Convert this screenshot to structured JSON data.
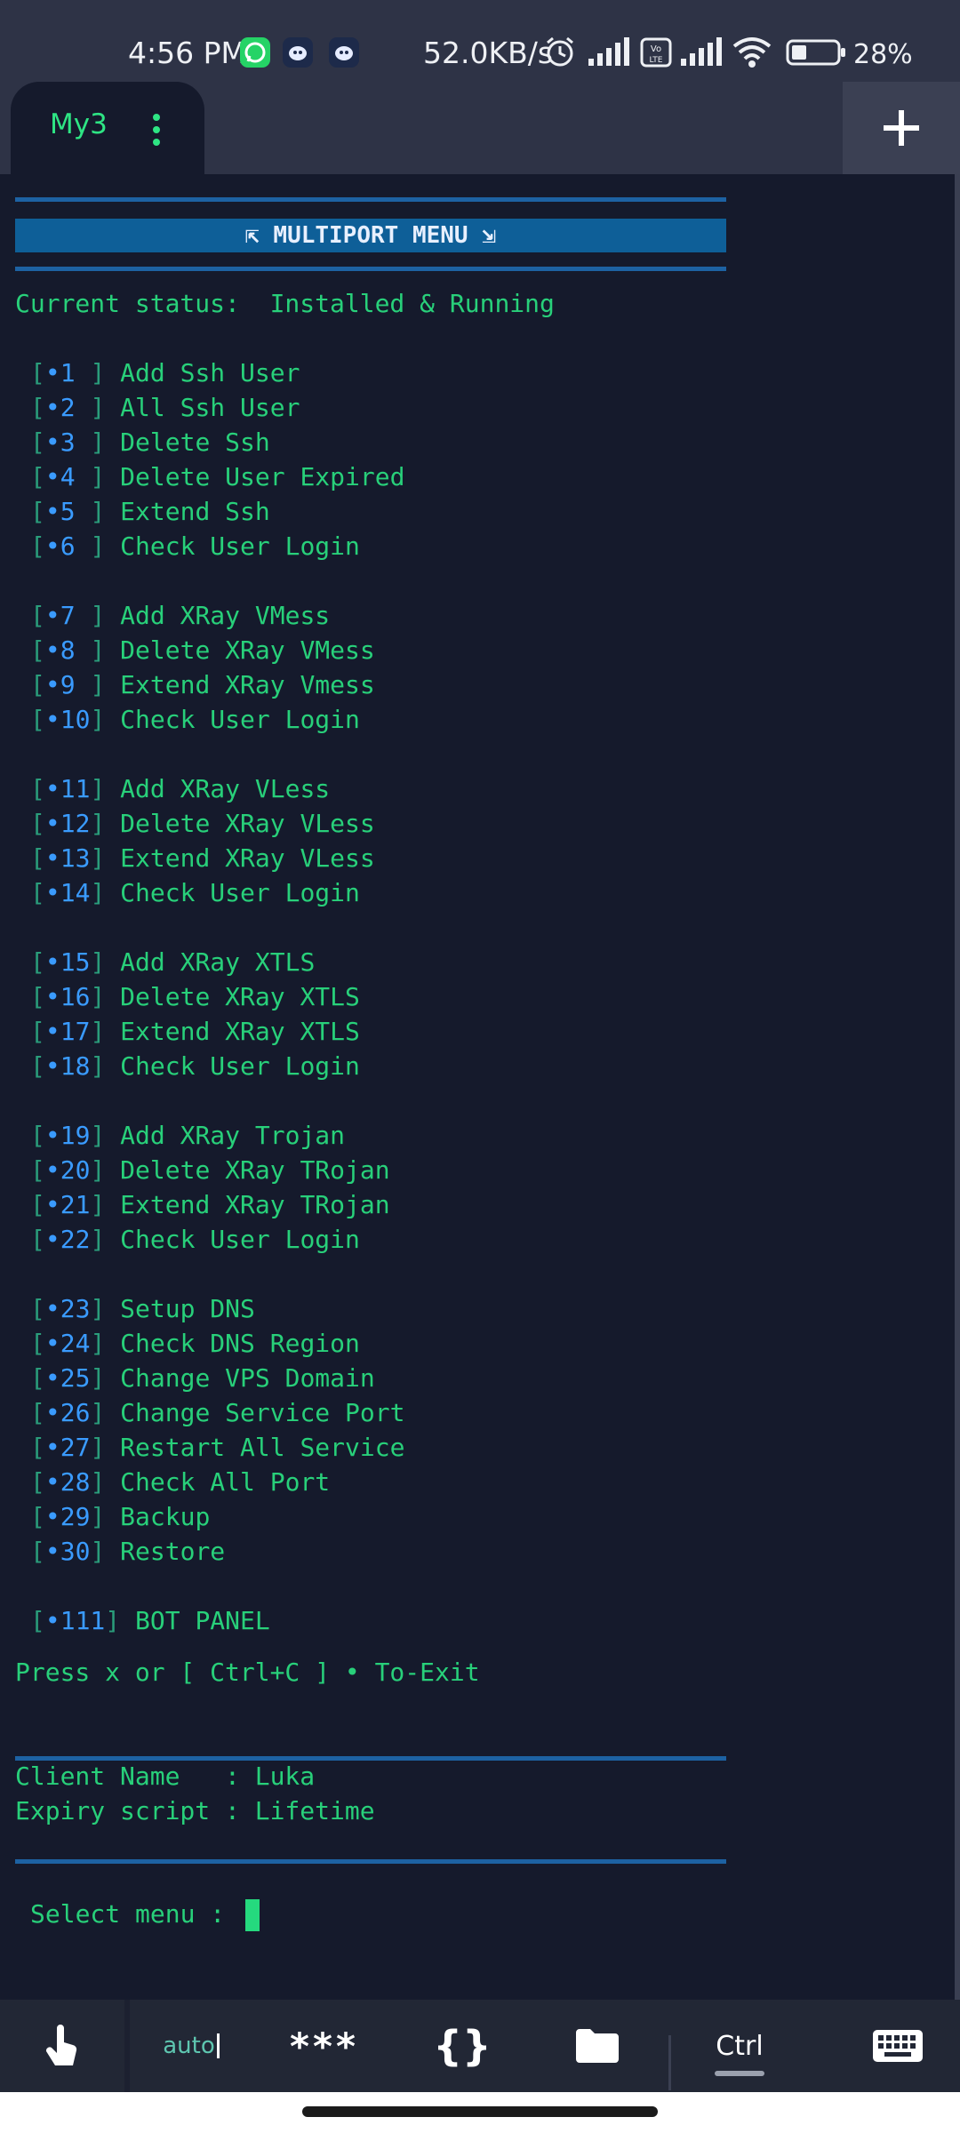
{
  "status_bar": {
    "time": "4:56 PM",
    "net_rate": "52.0KB/s",
    "battery_pct": "28%",
    "icons": [
      "whatsapp-icon",
      "app-icon",
      "app-icon",
      "alarm-icon",
      "signal-icon",
      "volte-icon",
      "signal-icon",
      "wifi-icon",
      "battery-icon"
    ]
  },
  "tab_bar": {
    "tab_label": "My3",
    "tab_menu_icon": "vertical-dots-icon",
    "add_icon": "plus-icon"
  },
  "terminal": {
    "banner": "⇱ MULTIPORT MENU ⇲",
    "status_line": "Current status:  Installed & Running",
    "items": [
      {
        "num": "•1 ",
        "label": "Add Ssh User"
      },
      {
        "num": "•2 ",
        "label": "All Ssh User"
      },
      {
        "num": "•3 ",
        "label": "Delete Ssh"
      },
      {
        "num": "•4 ",
        "label": "Delete User Expired"
      },
      {
        "num": "•5 ",
        "label": "Extend Ssh"
      },
      {
        "num": "•6 ",
        "label": "Check User Login"
      },
      {
        "num": "•7 ",
        "label": "Add XRay VMess"
      },
      {
        "num": "•8 ",
        "label": "Delete XRay VMess"
      },
      {
        "num": "•9 ",
        "label": "Extend XRay Vmess"
      },
      {
        "num": "•10",
        "label": "Check User Login"
      },
      {
        "num": "•11",
        "label": "Add XRay VLess"
      },
      {
        "num": "•12",
        "label": "Delete XRay VLess"
      },
      {
        "num": "•13",
        "label": "Extend XRay VLess"
      },
      {
        "num": "•14",
        "label": "Check User Login"
      },
      {
        "num": "•15",
        "label": "Add XRay XTLS"
      },
      {
        "num": "•16",
        "label": "Delete XRay XTLS"
      },
      {
        "num": "•17",
        "label": "Extend XRay XTLS"
      },
      {
        "num": "•18",
        "label": "Check User Login"
      },
      {
        "num": "•19",
        "label": "Add XRay Trojan"
      },
      {
        "num": "•20",
        "label": "Delete XRay TRojan"
      },
      {
        "num": "•21",
        "label": "Extend XRay TRojan"
      },
      {
        "num": "•22",
        "label": "Check User Login"
      },
      {
        "num": "•23",
        "label": "Setup DNS"
      },
      {
        "num": "•24",
        "label": "Check DNS Region"
      },
      {
        "num": "•25",
        "label": "Change VPS Domain"
      },
      {
        "num": "•26",
        "label": "Change Service Port"
      },
      {
        "num": "•27",
        "label": "Restart All Service"
      },
      {
        "num": "•28",
        "label": "Check All Port"
      },
      {
        "num": "•29",
        "label": "Backup"
      },
      {
        "num": "•30",
        "label": "Restore"
      },
      {
        "num": "•111",
        "label": "BOT PANEL"
      }
    ],
    "exit_hint": "Press x or [ Ctrl+C ] • To-Exit",
    "client_name": "Client Name   : Luka",
    "expiry": "Expiry script : Lifetime",
    "prompt": "Select menu : "
  },
  "toolbar": {
    "touch_icon": "touch-icon",
    "auto_label": "auto",
    "stars_label": "***",
    "braces_label": "{}",
    "folder_icon": "folder-icon",
    "ctrl_label": "Ctrl",
    "keyboard_icon": "keyboard-icon"
  }
}
